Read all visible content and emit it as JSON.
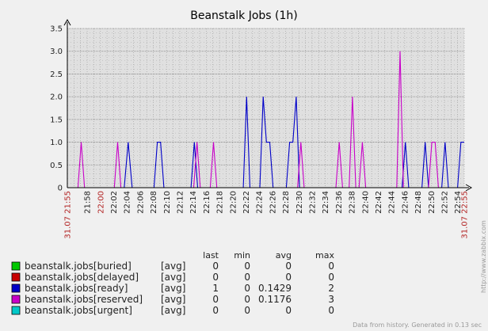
{
  "chart_data": {
    "type": "line",
    "title": "Beanstalk Jobs (1h)",
    "ylim": [
      0,
      3.5
    ],
    "y_ticks": [
      "0",
      "0.5",
      "1.0",
      "1.5",
      "2.0",
      "2.5",
      "3.0",
      "3.5"
    ],
    "x_tick_labels": [
      "31.07 21:55",
      "21:58",
      "22:00",
      "22:02",
      "22:04",
      "22:06",
      "22:08",
      "22:10",
      "22:12",
      "22:14",
      "22:16",
      "22:18",
      "22:20",
      "22:22",
      "22:24",
      "22:26",
      "22:28",
      "22:30",
      "22:32",
      "22:34",
      "22:36",
      "22:38",
      "22:40",
      "22:42",
      "22:44",
      "22:46",
      "22:48",
      "22:50",
      "22:52",
      "22:54",
      "31.07 22:55"
    ],
    "x_tick_minutes": [
      0,
      3,
      5,
      7,
      9,
      11,
      13,
      15,
      17,
      19,
      21,
      23,
      25,
      27,
      29,
      31,
      33,
      35,
      37,
      39,
      41,
      43,
      45,
      47,
      49,
      51,
      53,
      55,
      57,
      59,
      60
    ],
    "x_tick_red": [
      true,
      false,
      true,
      false,
      false,
      false,
      false,
      false,
      false,
      false,
      false,
      false,
      false,
      false,
      false,
      false,
      false,
      false,
      false,
      false,
      false,
      false,
      false,
      false,
      false,
      false,
      false,
      false,
      false,
      false,
      true
    ],
    "grid": true,
    "legend_columns": [
      "last",
      "min",
      "avg",
      "max"
    ],
    "series": [
      {
        "name": "beanstalk.jobs[buried]",
        "func": "[avg]",
        "color": "#00c800",
        "last": "0",
        "min": "0",
        "avg": "0",
        "max": "0",
        "points": [
          [
            0,
            0
          ],
          [
            60,
            0
          ]
        ]
      },
      {
        "name": "beanstalk.jobs[delayed]",
        "func": "[avg]",
        "color": "#c80000",
        "last": "0",
        "min": "0",
        "avg": "0",
        "max": "0",
        "points": [
          [
            0,
            0
          ],
          [
            60,
            0
          ]
        ]
      },
      {
        "name": "beanstalk.jobs[ready]",
        "func": "[avg]",
        "color": "#0000c8",
        "last": "1",
        "min": "0",
        "avg": "0.1429",
        "max": "2",
        "points": [
          [
            0,
            0
          ],
          [
            8.6,
            0
          ],
          [
            9.2,
            1
          ],
          [
            9.8,
            0
          ],
          [
            13.1,
            0
          ],
          [
            13.6,
            1
          ],
          [
            14.1,
            1
          ],
          [
            14.6,
            0
          ],
          [
            18.7,
            0
          ],
          [
            19.2,
            1
          ],
          [
            19.7,
            0
          ],
          [
            26.6,
            0
          ],
          [
            27.1,
            2
          ],
          [
            27.6,
            0
          ],
          [
            29.1,
            0
          ],
          [
            29.6,
            2
          ],
          [
            30.1,
            1
          ],
          [
            30.6,
            1
          ],
          [
            31.1,
            0
          ],
          [
            33.1,
            0
          ],
          [
            33.6,
            1
          ],
          [
            34.1,
            1
          ],
          [
            34.6,
            2
          ],
          [
            35.1,
            0
          ],
          [
            50.6,
            0
          ],
          [
            51.1,
            1
          ],
          [
            51.6,
            0
          ],
          [
            53.6,
            0
          ],
          [
            54.1,
            1
          ],
          [
            54.6,
            0
          ],
          [
            56.6,
            0
          ],
          [
            57.1,
            1
          ],
          [
            57.6,
            0
          ],
          [
            59.0,
            0
          ],
          [
            59.5,
            1
          ],
          [
            60,
            1
          ]
        ]
      },
      {
        "name": "beanstalk.jobs[reserved]",
        "func": "[avg]",
        "color": "#c800c8",
        "last": "0",
        "min": "0",
        "avg": "0.1176",
        "max": "3",
        "points": [
          [
            0,
            0
          ],
          [
            1.6,
            0
          ],
          [
            2.1,
            1
          ],
          [
            2.6,
            0
          ],
          [
            7.1,
            0
          ],
          [
            7.6,
            1
          ],
          [
            8.1,
            0
          ],
          [
            19.1,
            0
          ],
          [
            19.6,
            1
          ],
          [
            20.1,
            0
          ],
          [
            21.6,
            0
          ],
          [
            22.1,
            1
          ],
          [
            22.6,
            0
          ],
          [
            34.8,
            0
          ],
          [
            35.3,
            1
          ],
          [
            35.8,
            0
          ],
          [
            40.6,
            0
          ],
          [
            41.1,
            1
          ],
          [
            41.6,
            0
          ],
          [
            42.6,
            0
          ],
          [
            43.1,
            2
          ],
          [
            43.6,
            0
          ],
          [
            44.1,
            0
          ],
          [
            44.6,
            1
          ],
          [
            45.1,
            0
          ],
          [
            49.8,
            0
          ],
          [
            50.3,
            3
          ],
          [
            50.8,
            0
          ],
          [
            54.6,
            0
          ],
          [
            55.1,
            1
          ],
          [
            55.6,
            1
          ],
          [
            56.1,
            0
          ],
          [
            60,
            0
          ]
        ]
      },
      {
        "name": "beanstalk.jobs[urgent]",
        "func": "[avg]",
        "color": "#00c8c8",
        "last": "0",
        "min": "0",
        "avg": "0",
        "max": "0",
        "points": [
          [
            0,
            0
          ],
          [
            60,
            0
          ]
        ]
      }
    ]
  },
  "footer": "Data from history. Generated in 0.13 sec",
  "side_text": "http://www.zabbix.com"
}
